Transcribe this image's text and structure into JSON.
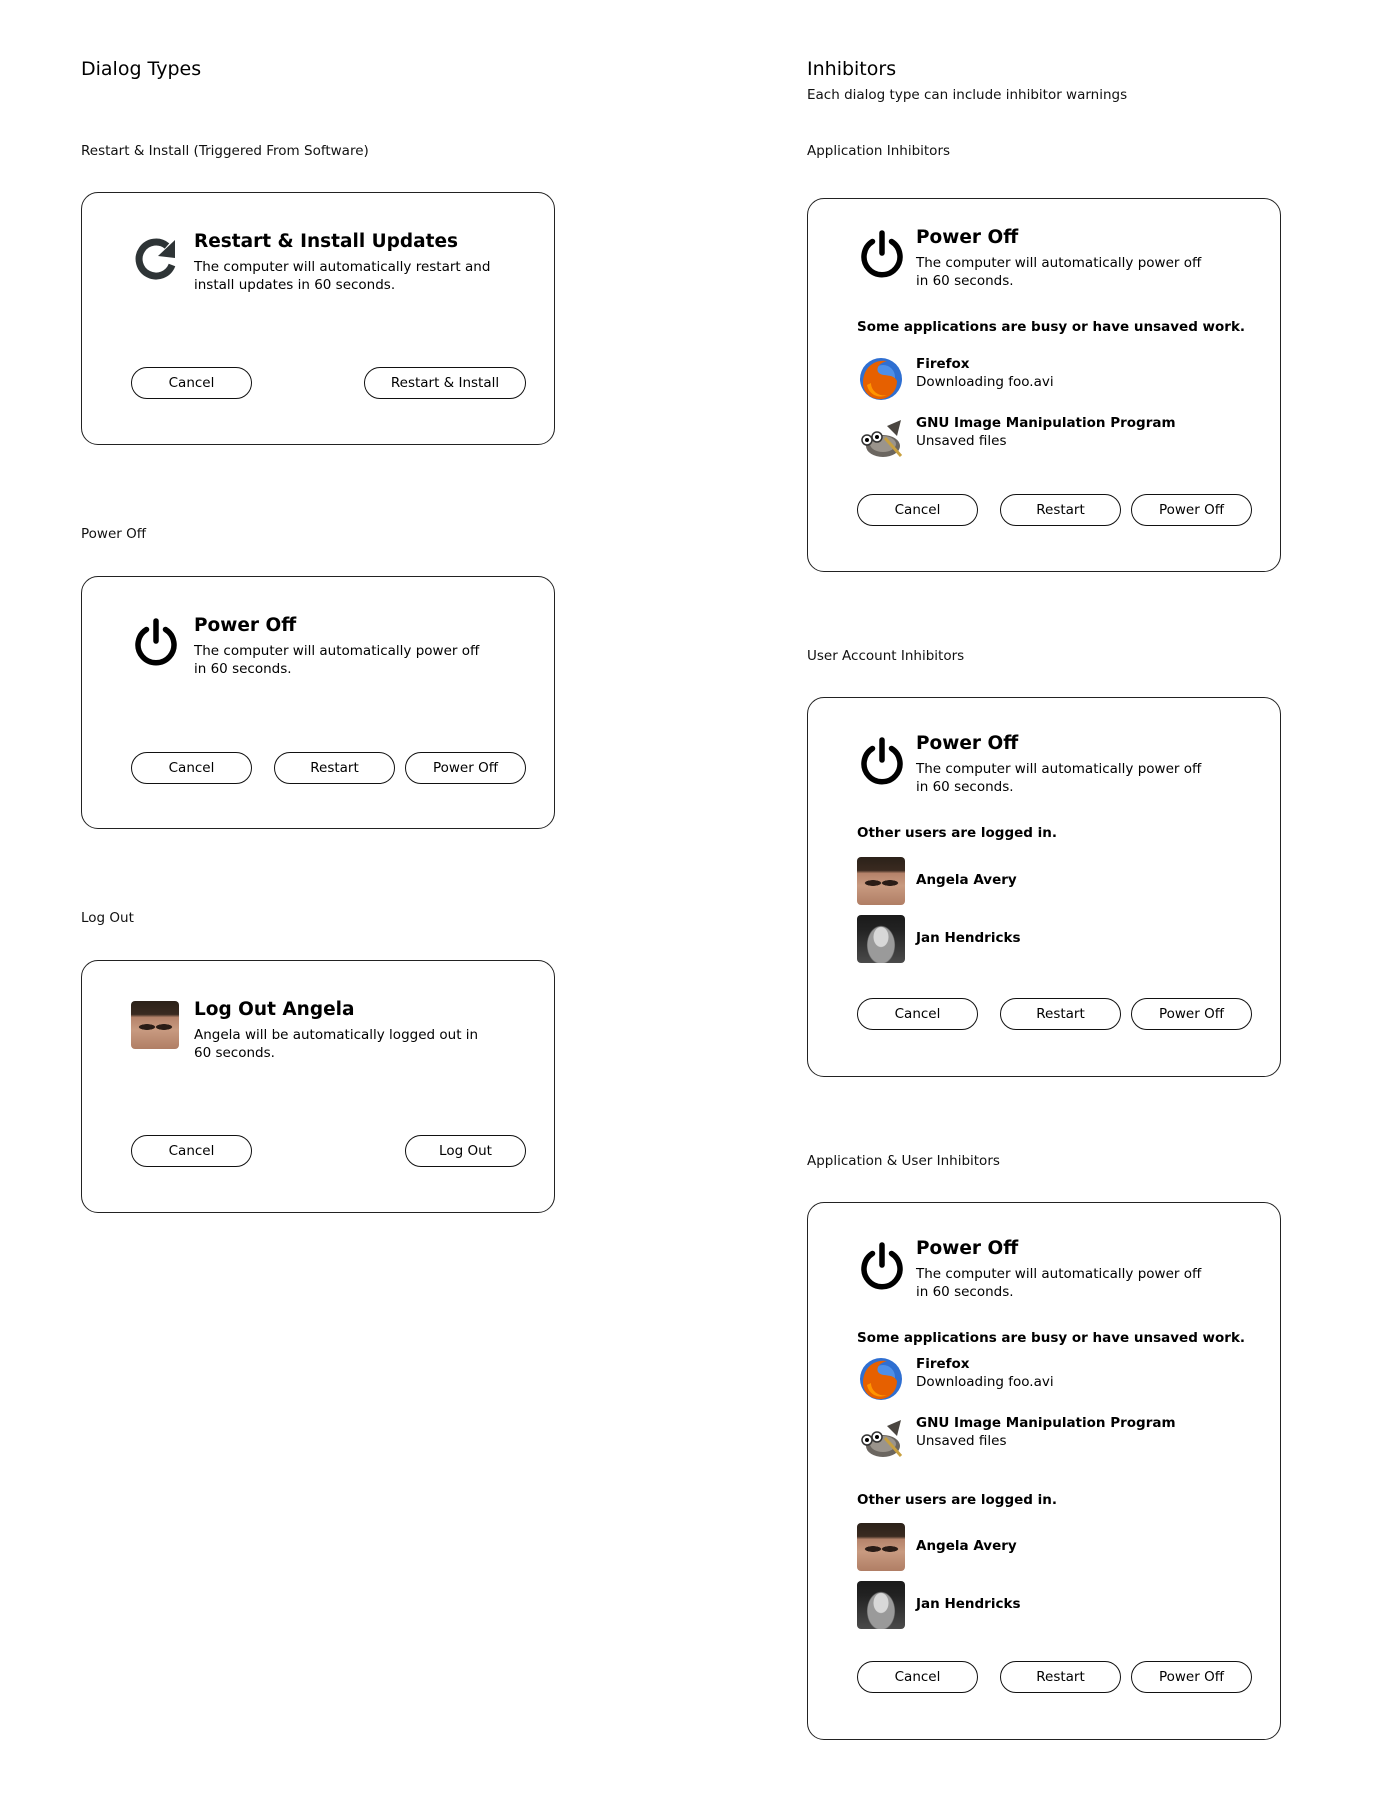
{
  "left": {
    "title": "Dialog Types",
    "captions": {
      "restart_install": "Restart & Install (Triggered From Software)",
      "power_off": "Power Off",
      "log_out": "Log Out"
    },
    "restart_dialog": {
      "title": "Restart & Install Updates",
      "text": "The computer will automatically restart and install updates in 60 seconds.",
      "icon": "restart-icon",
      "buttons": {
        "cancel": "Cancel",
        "confirm": "Restart & Install"
      }
    },
    "power_dialog": {
      "title": "Power Off",
      "text": "The computer will automatically power off in 60 seconds.",
      "icon": "power-icon",
      "buttons": {
        "cancel": "Cancel",
        "restart": "Restart",
        "power_off": "Power Off"
      }
    },
    "logout_dialog": {
      "title": "Log Out Angela",
      "text": "Angela will be automatically logged out in 60 seconds.",
      "icon": "avatar",
      "buttons": {
        "cancel": "Cancel",
        "log_out": "Log Out"
      }
    }
  },
  "right": {
    "title": "Inhibitors",
    "subtitle": "Each dialog type can include inhibitor warnings",
    "captions": {
      "app": "Application Inhibitors",
      "user": "User Account Inhibitors",
      "both": "Application & User Inhibitors"
    },
    "dialog_common": {
      "title": "Power Off",
      "text": "The computer will automatically power off in 60 seconds.",
      "app_heading": "Some applications are busy or have unsaved work.",
      "user_heading": "Other users are logged in.",
      "buttons": {
        "cancel": "Cancel",
        "restart": "Restart",
        "power_off": "Power Off"
      }
    },
    "apps": [
      {
        "name": "Firefox",
        "status": "Downloading foo.avi",
        "icon": "firefox-icon"
      },
      {
        "name": "GNU Image Manipulation Program",
        "status": "Unsaved files",
        "icon": "gimp-icon"
      }
    ],
    "users": [
      {
        "name": "Angela Avery",
        "icon": "avatar"
      },
      {
        "name": "Jan Hendricks",
        "icon": "avatar"
      }
    ]
  }
}
